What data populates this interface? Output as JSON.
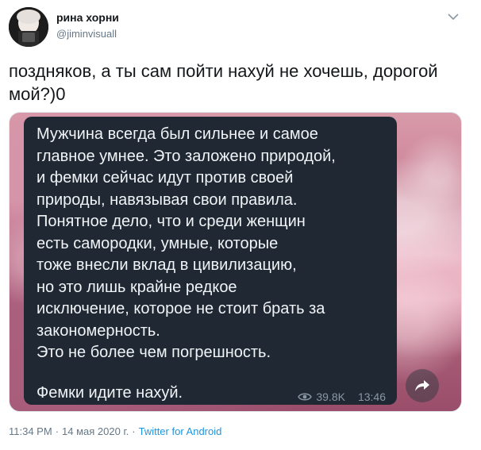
{
  "user": {
    "display_name": "рина хорни",
    "handle": "@jiminvisuall"
  },
  "tweet": {
    "text": "поздняков, а ты сам пойти нахуй не хочешь, дорогой мой?)0"
  },
  "media": {
    "message_text": "Мужчина всегда был сильнее и самое\nглавное умнее. Это заложено природой,\nи фемки сейчас идут против своей\nприроды, навязывая свои правила.\nПонятное дело, что и среди женщин\nесть самородки, умные, которые\nтоже внесли вклад в цивилизацию,\nно это лишь крайне редкое\nисключение, которое не стоит брать за\nзакономерность.\nЭто не более чем погрешность.",
    "message_last_line": "Фемки идите нахуй.",
    "views": "39.8K",
    "time": "13:46"
  },
  "footer": {
    "time": "11:34 PM",
    "separator": "·",
    "date": "14 мая 2020 г.",
    "source": "Twitter for Android"
  },
  "colors": {
    "link": "#1b95e0",
    "muted": "#657786",
    "bubble": "#1f2833"
  },
  "icons": [
    "chevron-down-icon",
    "eye-icon",
    "share-arrow-icon"
  ]
}
